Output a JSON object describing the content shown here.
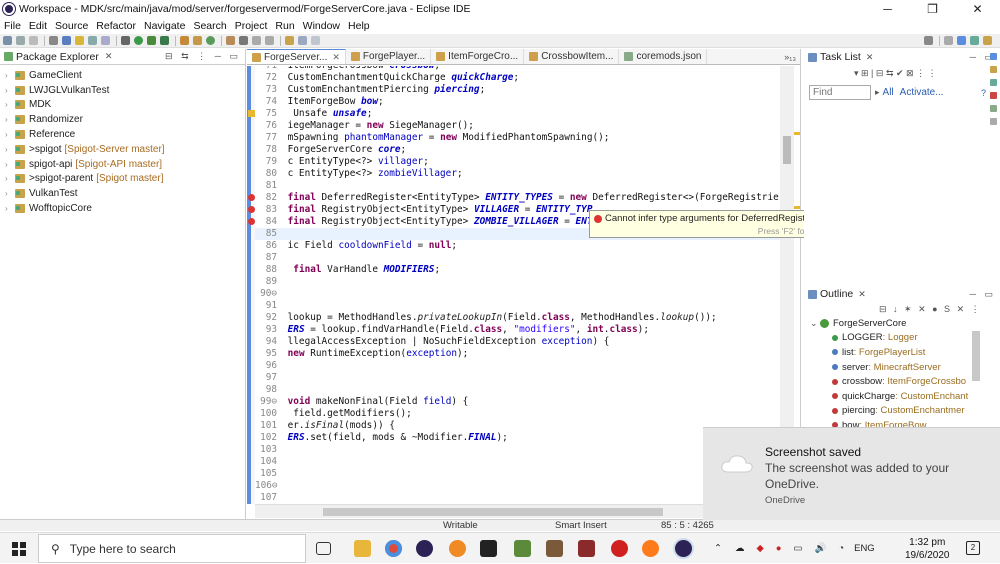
{
  "window": {
    "title": "Workspace - MDK/src/main/java/mod/server/forgeservermod/ForgeServerCore.java - Eclipse IDE",
    "minimize": "─",
    "maximize": "❐",
    "close": "✕"
  },
  "menu": [
    "File",
    "Edit",
    "Source",
    "Refactor",
    "Navigate",
    "Search",
    "Project",
    "Run",
    "Window",
    "Help"
  ],
  "package_explorer": {
    "title": "Package Explorer",
    "items": [
      {
        "label": "GameClient",
        "tag": "",
        "prefix": ""
      },
      {
        "label": "LWJGLVulkanTest",
        "tag": "",
        "prefix": ""
      },
      {
        "label": "MDK",
        "tag": "",
        "prefix": ""
      },
      {
        "label": "Randomizer",
        "tag": "",
        "prefix": ""
      },
      {
        "label": "Reference",
        "tag": "",
        "prefix": ""
      },
      {
        "label": "spigot",
        "tag": "[Spigot-Server master]",
        "prefix": "> "
      },
      {
        "label": "spigot-api",
        "tag": "[Spigot-API master]",
        "prefix": ""
      },
      {
        "label": "spigot-parent",
        "tag": "[Spigot master]",
        "prefix": "> "
      },
      {
        "label": "VulkanTest",
        "tag": "",
        "prefix": ""
      },
      {
        "label": "WofftopicCore",
        "tag": "",
        "prefix": ""
      }
    ]
  },
  "editor": {
    "tabs": [
      "ForgeServer...",
      "ForgePlayer...",
      "ItemForgeCro...",
      "CrossbowItem...",
      "coremods.json"
    ],
    "tab_overflow": "»₁₃",
    "lines": [
      {
        "n": "71",
        "segs": [
          [
            "",
            " ItemForgeCrossbow "
          ],
          [
            "itf",
            "crossbow"
          ],
          [
            "",
            ";"
          ]
        ]
      },
      {
        "n": "72",
        "segs": [
          [
            "",
            " CustomEnchantmentQuickCharge "
          ],
          [
            "itf",
            "quickCharge"
          ],
          [
            "",
            ";"
          ]
        ]
      },
      {
        "n": "73",
        "segs": [
          [
            "",
            " CustomEnchantmentPiercing "
          ],
          [
            "itf",
            "piercing"
          ],
          [
            "",
            ";"
          ]
        ]
      },
      {
        "n": "74",
        "segs": [
          [
            "",
            " ItemForgeBow "
          ],
          [
            "itf",
            "bow"
          ],
          [
            "",
            ";"
          ]
        ]
      },
      {
        "n": "75",
        "segs": [
          [
            "",
            "  Unsafe "
          ],
          [
            "itf",
            "unsafe"
          ],
          [
            "",
            ";"
          ]
        ]
      },
      {
        "n": "76",
        "segs": [
          [
            "",
            " iegeManager = "
          ],
          [
            "kw",
            "new"
          ],
          [
            "",
            " SiegeManager();"
          ]
        ]
      },
      {
        "n": "77",
        "segs": [
          [
            "",
            " mSpawning "
          ],
          [
            "fld",
            "phantomManager"
          ],
          [
            "",
            " = "
          ],
          [
            "kw",
            "new"
          ],
          [
            "",
            " ModifiedPhantomSpawning();"
          ]
        ]
      },
      {
        "n": "78",
        "segs": [
          [
            "",
            " ForgeServerCore "
          ],
          [
            "itf",
            "core"
          ],
          [
            "",
            ";"
          ]
        ]
      },
      {
        "n": "79",
        "segs": [
          [
            "",
            " c EntityType<?> "
          ],
          [
            "fld",
            "villager"
          ],
          [
            "",
            ";"
          ]
        ]
      },
      {
        "n": "80",
        "segs": [
          [
            "",
            " c EntityType<?> "
          ],
          [
            "fld",
            "zombieVillager"
          ],
          [
            "",
            ";"
          ]
        ]
      },
      {
        "n": "81",
        "segs": [
          [
            "",
            ""
          ]
        ]
      },
      {
        "n": "82",
        "segs": [
          [
            "",
            " "
          ],
          [
            "kw",
            "final"
          ],
          [
            "",
            " DeferredRegister<EntityType> "
          ],
          [
            "itf",
            "ENTITY_TYPES"
          ],
          [
            "",
            " = "
          ],
          [
            "kw",
            "new"
          ],
          [
            "",
            " DeferredRegister<>(ForgeRegistrie"
          ]
        ]
      },
      {
        "n": "83",
        "segs": [
          [
            "",
            " "
          ],
          [
            "kw",
            "final"
          ],
          [
            "",
            " RegistryObject<EntityType> "
          ],
          [
            "itf",
            "VILLAGER"
          ],
          [
            "",
            " = "
          ],
          [
            "itf",
            "ENTITY_TYP"
          ]
        ]
      },
      {
        "n": "84",
        "segs": [
          [
            "",
            " "
          ],
          [
            "kw",
            "final"
          ],
          [
            "",
            " RegistryObject<EntityType> "
          ],
          [
            "itf",
            "ZOMBIE_VILLAGER"
          ],
          [
            "",
            " = "
          ],
          [
            "itf",
            "ENT"
          ]
        ]
      },
      {
        "n": "85",
        "segs": [
          [
            "",
            ""
          ]
        ]
      },
      {
        "n": "86",
        "segs": [
          [
            "",
            " ic Field "
          ],
          [
            "fld",
            "cooldownField"
          ],
          [
            "",
            " = "
          ],
          [
            "kw",
            "null"
          ],
          [
            "",
            ";"
          ]
        ]
      },
      {
        "n": "87",
        "segs": [
          [
            "",
            ""
          ]
        ]
      },
      {
        "n": "88",
        "segs": [
          [
            "",
            "  "
          ],
          [
            "kw",
            "final"
          ],
          [
            "",
            " VarHandle "
          ],
          [
            "itf",
            "MODIFIERS"
          ],
          [
            "",
            ";"
          ]
        ]
      },
      {
        "n": "89",
        "segs": [
          [
            "",
            ""
          ]
        ]
      },
      {
        "n": "90⊖",
        "segs": [
          [
            "",
            ""
          ]
        ]
      },
      {
        "n": "91",
        "segs": [
          [
            "",
            ""
          ]
        ]
      },
      {
        "n": "92",
        "segs": [
          [
            "",
            " lookup = MethodHandles."
          ],
          [
            "it",
            "privateLookupIn"
          ],
          [
            "",
            "(Field."
          ],
          [
            "kw",
            "class"
          ],
          [
            "",
            ", MethodHandles."
          ],
          [
            "it",
            "lookup"
          ],
          [
            "",
            "());"
          ]
        ]
      },
      {
        "n": "93",
        "segs": [
          [
            "",
            " "
          ],
          [
            "itf",
            "ERS"
          ],
          [
            "",
            " = lookup.findVarHandle(Field."
          ],
          [
            "kw",
            "class"
          ],
          [
            "",
            ", "
          ],
          [
            "str",
            "\"modifiers\""
          ],
          [
            "",
            ", "
          ],
          [
            "kw",
            "int"
          ],
          [
            "",
            "."
          ],
          [
            "kw",
            "class"
          ],
          [
            "",
            ");"
          ]
        ]
      },
      {
        "n": "94",
        "segs": [
          [
            "",
            " llegalAccessException | NoSuchFieldException "
          ],
          [
            "fld",
            "exception"
          ],
          [
            "",
            ") {"
          ]
        ]
      },
      {
        "n": "95",
        "segs": [
          [
            "",
            " "
          ],
          [
            "kw",
            "new"
          ],
          [
            "",
            " RuntimeException("
          ],
          [
            "fld",
            "exception"
          ],
          [
            "",
            ");"
          ]
        ]
      },
      {
        "n": "96",
        "segs": [
          [
            "",
            ""
          ]
        ]
      },
      {
        "n": "97",
        "segs": [
          [
            "",
            ""
          ]
        ]
      },
      {
        "n": "98",
        "segs": [
          [
            "",
            ""
          ]
        ]
      },
      {
        "n": "99⊖",
        "segs": [
          [
            "",
            " "
          ],
          [
            "kw",
            "void"
          ],
          [
            "",
            " makeNonFinal(Field "
          ],
          [
            "fld",
            "field"
          ],
          [
            "",
            ") {"
          ]
        ]
      },
      {
        "n": "100",
        "segs": [
          [
            "",
            "  field.getModifiers();"
          ]
        ]
      },
      {
        "n": "101",
        "segs": [
          [
            "",
            " er."
          ],
          [
            "it",
            "isFinal"
          ],
          [
            "",
            "(mods)) {"
          ]
        ]
      },
      {
        "n": "102",
        "segs": [
          [
            "",
            " "
          ],
          [
            "itf",
            "ERS"
          ],
          [
            "",
            ".set(field, mods & ~Modifier."
          ],
          [
            "itf",
            "FINAL"
          ],
          [
            "",
            ");"
          ]
        ]
      },
      {
        "n": "103",
        "segs": [
          [
            "",
            ""
          ]
        ]
      },
      {
        "n": "104",
        "segs": [
          [
            "",
            ""
          ]
        ]
      },
      {
        "n": "105",
        "segs": [
          [
            "",
            ""
          ]
        ]
      },
      {
        "n": "106⊖",
        "segs": [
          [
            "",
            ""
          ]
        ]
      },
      {
        "n": "107",
        "segs": [
          [
            "",
            ""
          ]
        ]
      }
    ],
    "tooltip": {
      "message": "Cannot infer type arguments for DeferredRegister<>",
      "hint": "Press 'F2' for focus"
    }
  },
  "task_list": {
    "title": "Task List",
    "find_placeholder": "Find",
    "all_label": "All",
    "activate_label": "Activate..."
  },
  "outline": {
    "title": "Outline",
    "root": "ForgeServerCore",
    "items": [
      {
        "name": "LOGGER",
        "type": "Logger",
        "sup": "SF"
      },
      {
        "name": "list",
        "type": "ForgePlayerList",
        "sup": ""
      },
      {
        "name": "server",
        "type": "MinecraftServer",
        "sup": ""
      },
      {
        "name": "crossbow",
        "type": "ItemForgeCrossbo",
        "sup": "S"
      },
      {
        "name": "quickCharge",
        "type": "CustomEnchant",
        "sup": "S"
      },
      {
        "name": "piercing",
        "type": "CustomEnchantmer",
        "sup": "S"
      },
      {
        "name": "bow",
        "type": "ItemForgeBow",
        "sup": "S"
      }
    ]
  },
  "status": {
    "writable": "Writable",
    "insert_mode": "Smart Insert",
    "position": "85 : 5 : 4265"
  },
  "toast": {
    "title": "Screenshot saved",
    "body": "The screenshot was added to your OneDrive.",
    "source": "OneDrive"
  },
  "taskbar": {
    "search_placeholder": "Type here to search",
    "language": "ENG",
    "time": "1:32 pm",
    "date": "19/6/2020",
    "notifications": "2"
  },
  "colors": {
    "keyword": "#7f0055",
    "field": "#0000c0",
    "string": "#2a00ff",
    "error": "#dd3333",
    "accent": "#5b8bd6"
  }
}
